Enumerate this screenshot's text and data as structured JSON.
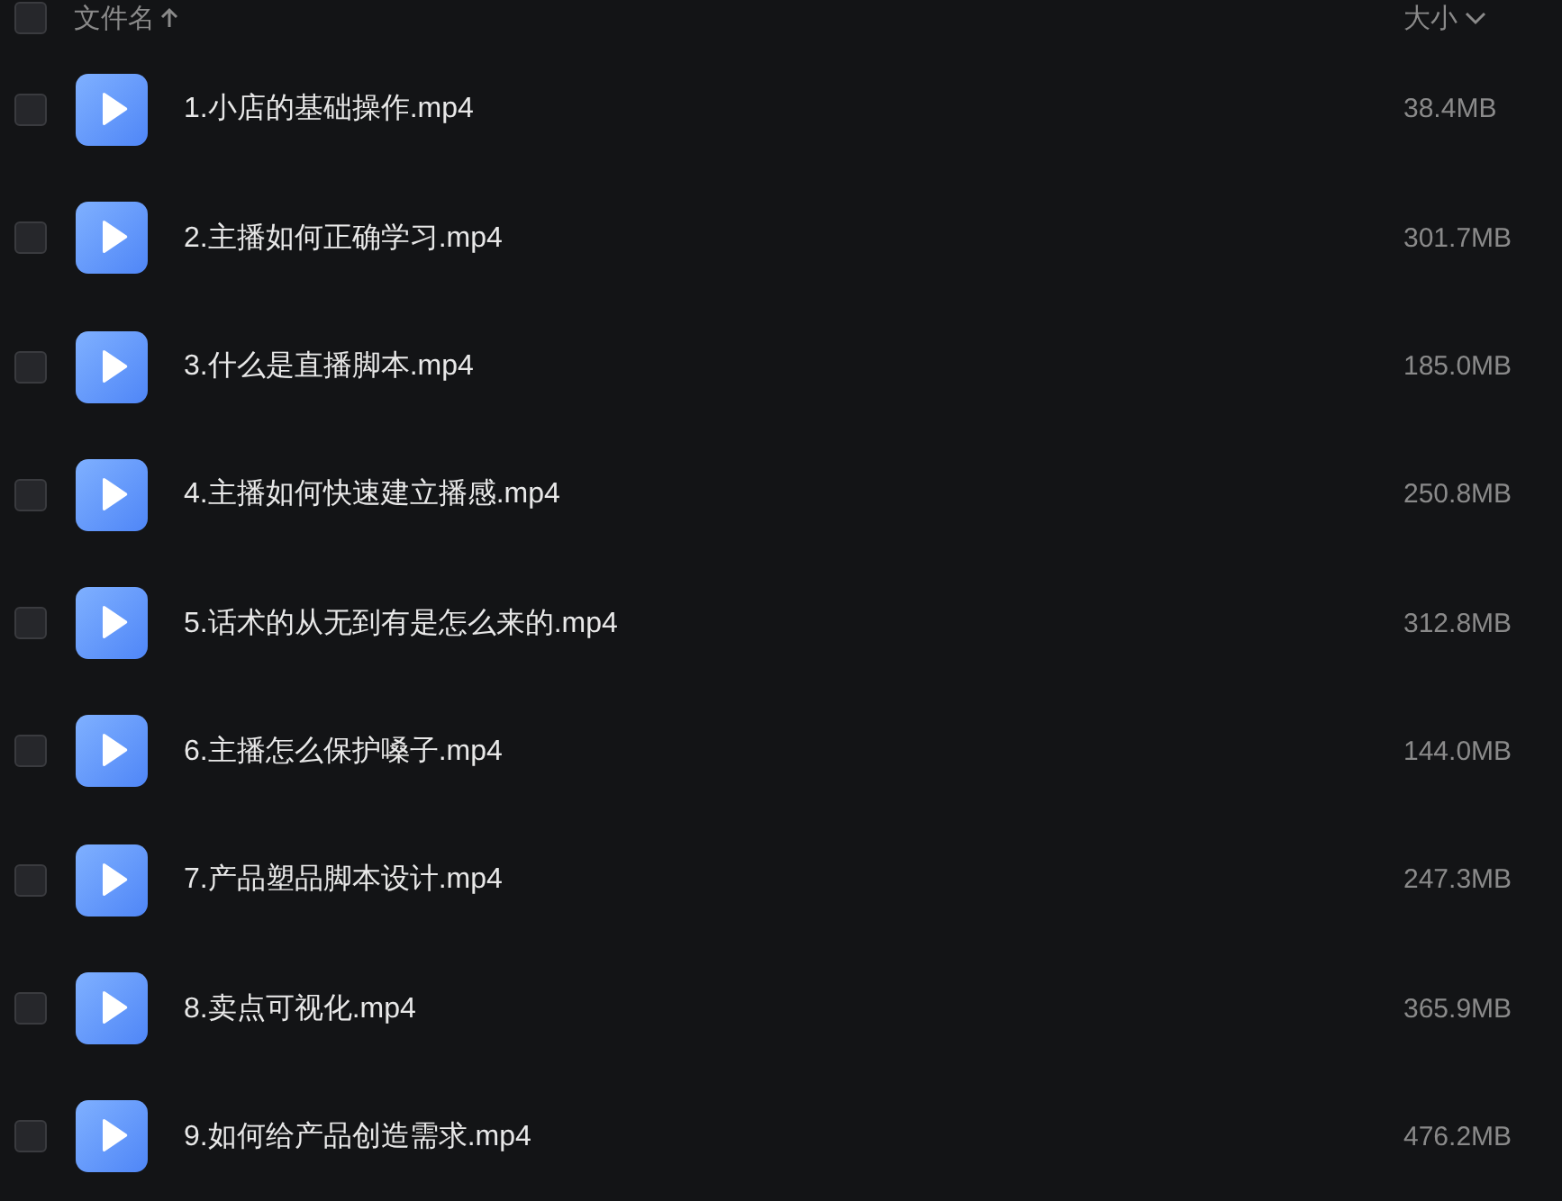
{
  "header": {
    "checked": false,
    "name_label": "文件名",
    "name_ascending": true,
    "size_label": "大小",
    "size_ascending": false
  },
  "files": [
    {
      "name": "1.小店的基础操作.mp4",
      "size": "38.4MB",
      "checked": false
    },
    {
      "name": "2.主播如何正确学习.mp4",
      "size": "301.7MB",
      "checked": false
    },
    {
      "name": "3.什么是直播脚本.mp4",
      "size": "185.0MB",
      "checked": false
    },
    {
      "name": "4.主播如何快速建立播感.mp4",
      "size": "250.8MB",
      "checked": false
    },
    {
      "name": "5.话术的从无到有是怎么来的.mp4",
      "size": "312.8MB",
      "checked": false
    },
    {
      "name": "6.主播怎么保护嗓子.mp4",
      "size": "144.0MB",
      "checked": false
    },
    {
      "name": "7.产品塑品脚本设计.mp4",
      "size": "247.3MB",
      "checked": false
    },
    {
      "name": "8.卖点可视化.mp4",
      "size": "365.9MB",
      "checked": false
    },
    {
      "name": "9.如何给产品创造需求.mp4",
      "size": "476.2MB",
      "checked": false
    }
  ]
}
